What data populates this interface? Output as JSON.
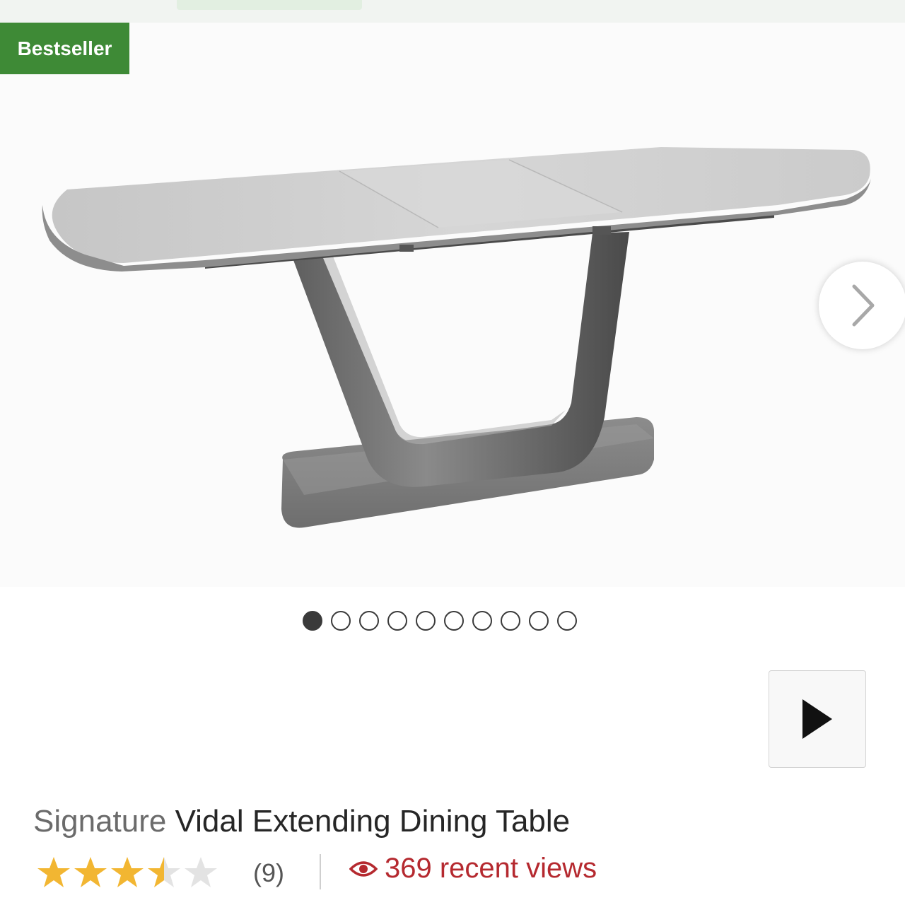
{
  "badge": {
    "label": "Bestseller",
    "color": "#3e8a36"
  },
  "gallery": {
    "image_alt": "Grey gloss extending dining table",
    "next_icon": "chevron-right-icon",
    "dot_count": 10,
    "active_dot_index": 0
  },
  "video": {
    "icon": "play-icon"
  },
  "product": {
    "brand": "Signature",
    "name": "Vidal Extending Dining Table"
  },
  "rating": {
    "value": 3.5,
    "max": 5,
    "count_label": "(9)",
    "star_color": "#f2b632"
  },
  "views": {
    "icon": "eye-icon",
    "label": "369 recent views",
    "color": "#b5292f"
  }
}
